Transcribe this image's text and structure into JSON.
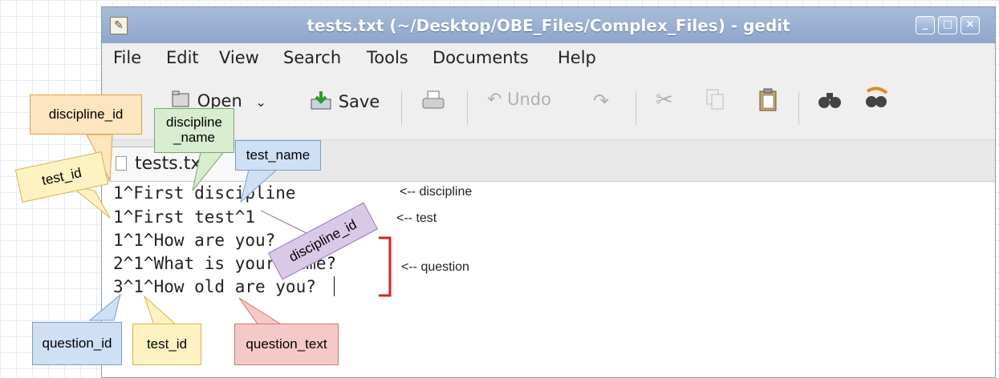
{
  "window": {
    "title": "tests.txt (~/Desktop/OBE_Files/Complex_Files) - gedit",
    "app_icon": "pencil-notepad-icon",
    "controls": [
      "minimize",
      "maximize",
      "close"
    ]
  },
  "menu": {
    "items": [
      "File",
      "Edit",
      "View",
      "Search",
      "Tools",
      "Documents",
      "Help"
    ]
  },
  "toolbar": {
    "open_label": "Open",
    "save_label": "Save",
    "undo_label": "Undo"
  },
  "tab": {
    "label": "tests.txt"
  },
  "editor": {
    "lines": [
      "1^First discipline",
      "1^First test^1",
      "1^1^How are you?",
      "2^1^What is your name?",
      "3^1^How old are you?"
    ]
  },
  "annotations": {
    "discipline_id": "discipline_id",
    "discipline_name": "discipline\n_name",
    "test_name": "test_name",
    "test_id_top": "test_id",
    "discipline_id_rotated": "discipline_id",
    "question_id": "question_id",
    "test_id_bottom": "test_id",
    "question_text": "question_text",
    "note_discipline": "<-- discipline",
    "note_test": "<-- test",
    "note_question": "<-- question"
  },
  "colors": {
    "orange_note": "#fde5c0",
    "green_note": "#d8ecd0",
    "blue_note": "#cfe0f5",
    "yellow_note": "#fff2c2",
    "purple_note": "#d9c9e6",
    "pink_note": "#f5c9c6",
    "bracket": "#e02020"
  }
}
